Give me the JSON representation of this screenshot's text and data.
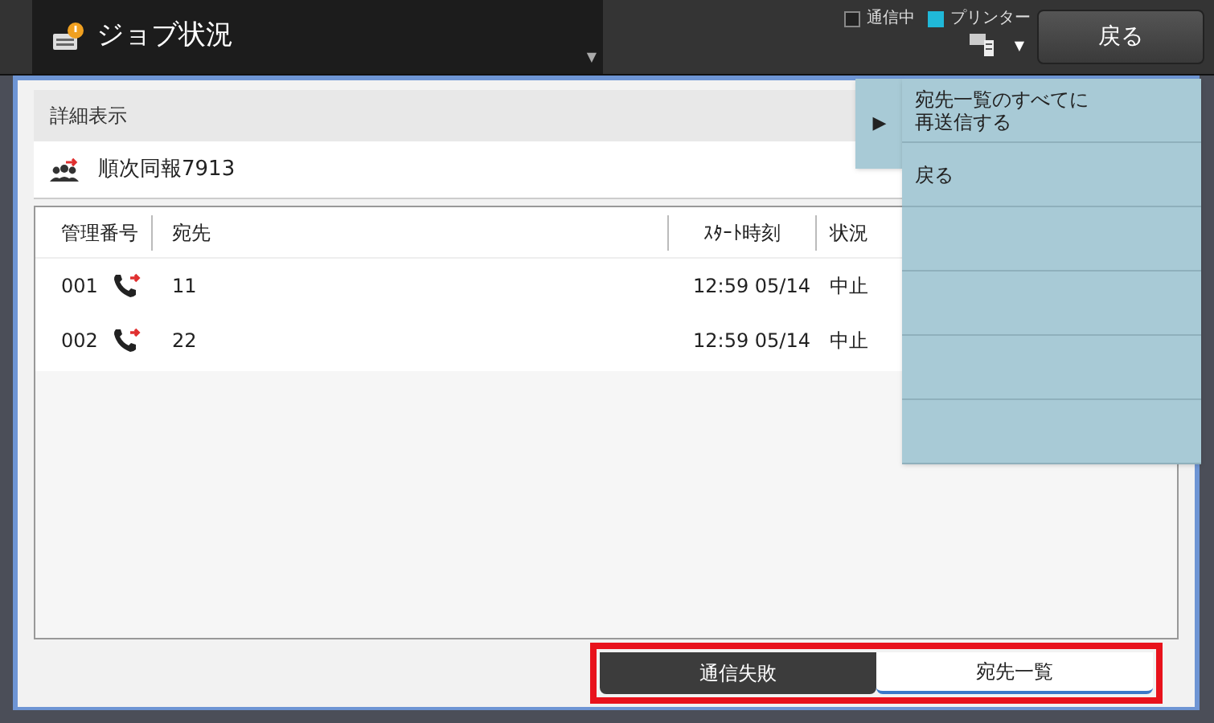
{
  "header": {
    "title": "ジョブ状況",
    "title_dropdown": "▼",
    "printer_dropdown": "▼",
    "status": [
      {
        "label": "通信中",
        "on": false
      },
      {
        "label": "プリンター",
        "on": true
      }
    ],
    "back_button": "戻る"
  },
  "detail": {
    "heading": "詳細表示",
    "job_name": "順次同報7913"
  },
  "table": {
    "columns": [
      "管理番号",
      "宛先",
      "ｽﾀｰﾄ時刻",
      "状況"
    ],
    "rows": [
      {
        "id": "001",
        "destination": "11",
        "start_time": "12:59 05/14",
        "status": "中止"
      },
      {
        "id": "002",
        "destination": "22",
        "start_time": "12:59 05/14",
        "status": "中止"
      }
    ]
  },
  "side_menu": {
    "toggle": "▶",
    "items": [
      {
        "lines": [
          "宛先一覧のすべてに",
          "再送信する"
        ]
      },
      {
        "lines": [
          "戻る"
        ]
      }
    ]
  },
  "bottom_tabs": [
    {
      "label": "通信失敗",
      "selected": false
    },
    {
      "label": "宛先一覧",
      "selected": true
    }
  ]
}
